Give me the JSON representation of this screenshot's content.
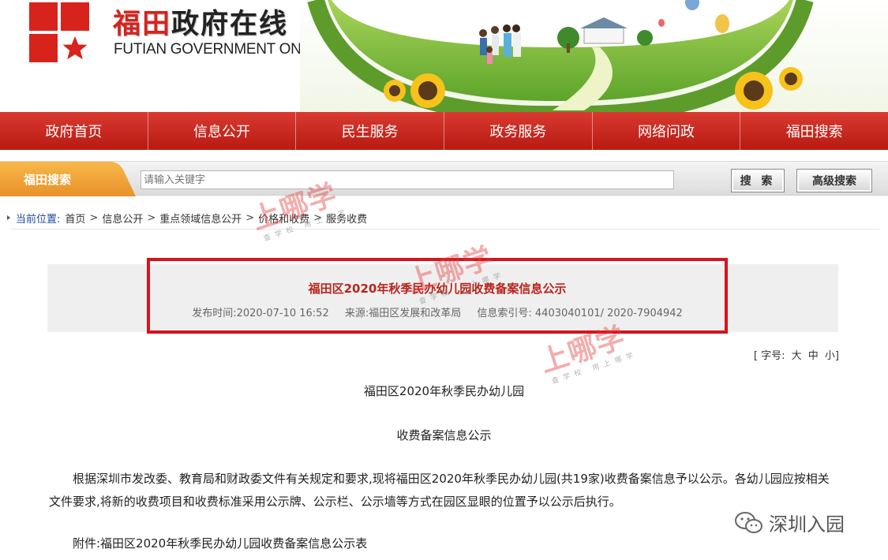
{
  "header": {
    "title_red": "福田",
    "title_black": "政府在线",
    "subtitle": "FUTIAN GOVERNMENT ONLINE"
  },
  "nav": {
    "items": [
      {
        "label": "政府首页"
      },
      {
        "label": "信息公开"
      },
      {
        "label": "民生服务"
      },
      {
        "label": "政务服务"
      },
      {
        "label": "网络问政"
      },
      {
        "label": "福田搜索"
      }
    ]
  },
  "search": {
    "tab_label": "福田搜索",
    "placeholder": "请输入关键字",
    "search_button": "搜 索",
    "advanced_button": "高级搜索"
  },
  "breadcrumb": {
    "current_label": "当前位置:",
    "items": [
      "首页",
      "信息公开",
      "重点领域信息公开",
      "价格和收费",
      "服务收费"
    ]
  },
  "article": {
    "title": "福田区2020年秋季民办幼儿园收费备案信息公示",
    "publish_time": "发布时间:2020-07-10 16:52",
    "source": "来源:福田区发展和改革局",
    "index_no": "信息索引号: 4403040101/ 2020-7904942",
    "font_size_label": "[ 字号:",
    "font_size_options": [
      "大",
      "中",
      "小"
    ],
    "font_size_close": "]",
    "heading_line1": "福田区2020年秋季民办幼儿园",
    "heading_line2": "收费备案信息公示",
    "paragraph": "根据深圳市发改委、教育局和财政委文件有关规定和要求,现将福田区2020年秋季民办幼儿园(共19家)收费备案信息予以公示。各幼儿园应按相关文件要求,将新的收费项目和收费标准采用公示牌、公示栏、公示墙等方式在园区显眼的位置予以公示后执行。",
    "attachment": "附件:福田区2020年秋季民办幼儿园收费备案信息公示表"
  },
  "watermarks": {
    "brand": "上哪学",
    "tagline": "查学校 用上哪学"
  },
  "wechat": {
    "account": "深圳入园"
  },
  "colors": {
    "brand_red": "#d7231c",
    "nav_red": "#c8261d",
    "title_red": "#b9241c",
    "search_tab_orange": "#f0a136",
    "highlight_border": "#d7131d"
  }
}
